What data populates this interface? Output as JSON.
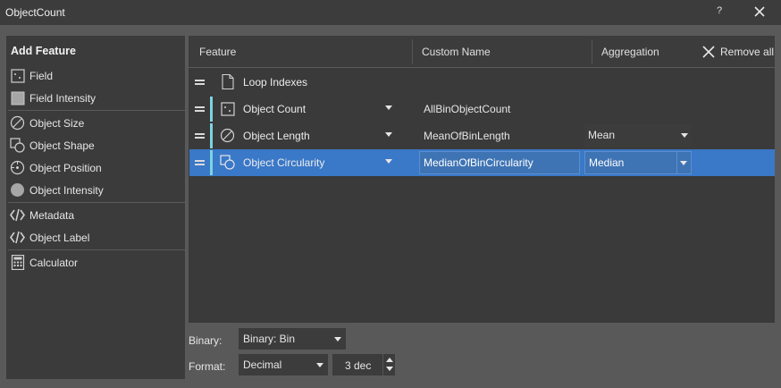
{
  "window": {
    "title": "ObjectCount",
    "help_label": "?"
  },
  "left_panel": {
    "header": "Add Feature",
    "items": [
      {
        "label": "Field",
        "icon": "field-icon"
      },
      {
        "label": "Field Intensity",
        "icon": "field-intensity-icon"
      },
      {
        "label": "Object Size",
        "icon": "object-size-icon"
      },
      {
        "label": "Object Shape",
        "icon": "object-shape-icon"
      },
      {
        "label": "Object Position",
        "icon": "object-position-icon"
      },
      {
        "label": "Object Intensity",
        "icon": "object-intensity-icon"
      },
      {
        "label": "Metadata",
        "icon": "code-icon"
      },
      {
        "label": "Object Label",
        "icon": "code-icon"
      },
      {
        "label": "Calculator",
        "icon": "calculator-icon"
      }
    ]
  },
  "table": {
    "headers": {
      "feature": "Feature",
      "custom_name": "Custom Name",
      "aggregation": "Aggregation"
    },
    "remove_all_label": "Remove all",
    "rows": [
      {
        "feature": "Loop Indexes",
        "custom_name": "",
        "aggregation": ""
      },
      {
        "feature": "Object Count",
        "custom_name": "AllBinObjectCount",
        "aggregation": ""
      },
      {
        "feature": "Object Length",
        "custom_name": "MeanOfBinLength",
        "aggregation": "Mean"
      },
      {
        "feature": "Object Circularity",
        "custom_name": "MedianOfBinCircularity",
        "aggregation": "Median"
      }
    ]
  },
  "bottom": {
    "binary_label": "Binary:",
    "binary_value": "Binary: Bin",
    "format_label": "Format:",
    "format_value": "Decimal",
    "decimals_value": "3 dec"
  },
  "colors": {
    "selection": "#3a78c8",
    "accent": "#7ed3e0",
    "background": "#595959"
  }
}
